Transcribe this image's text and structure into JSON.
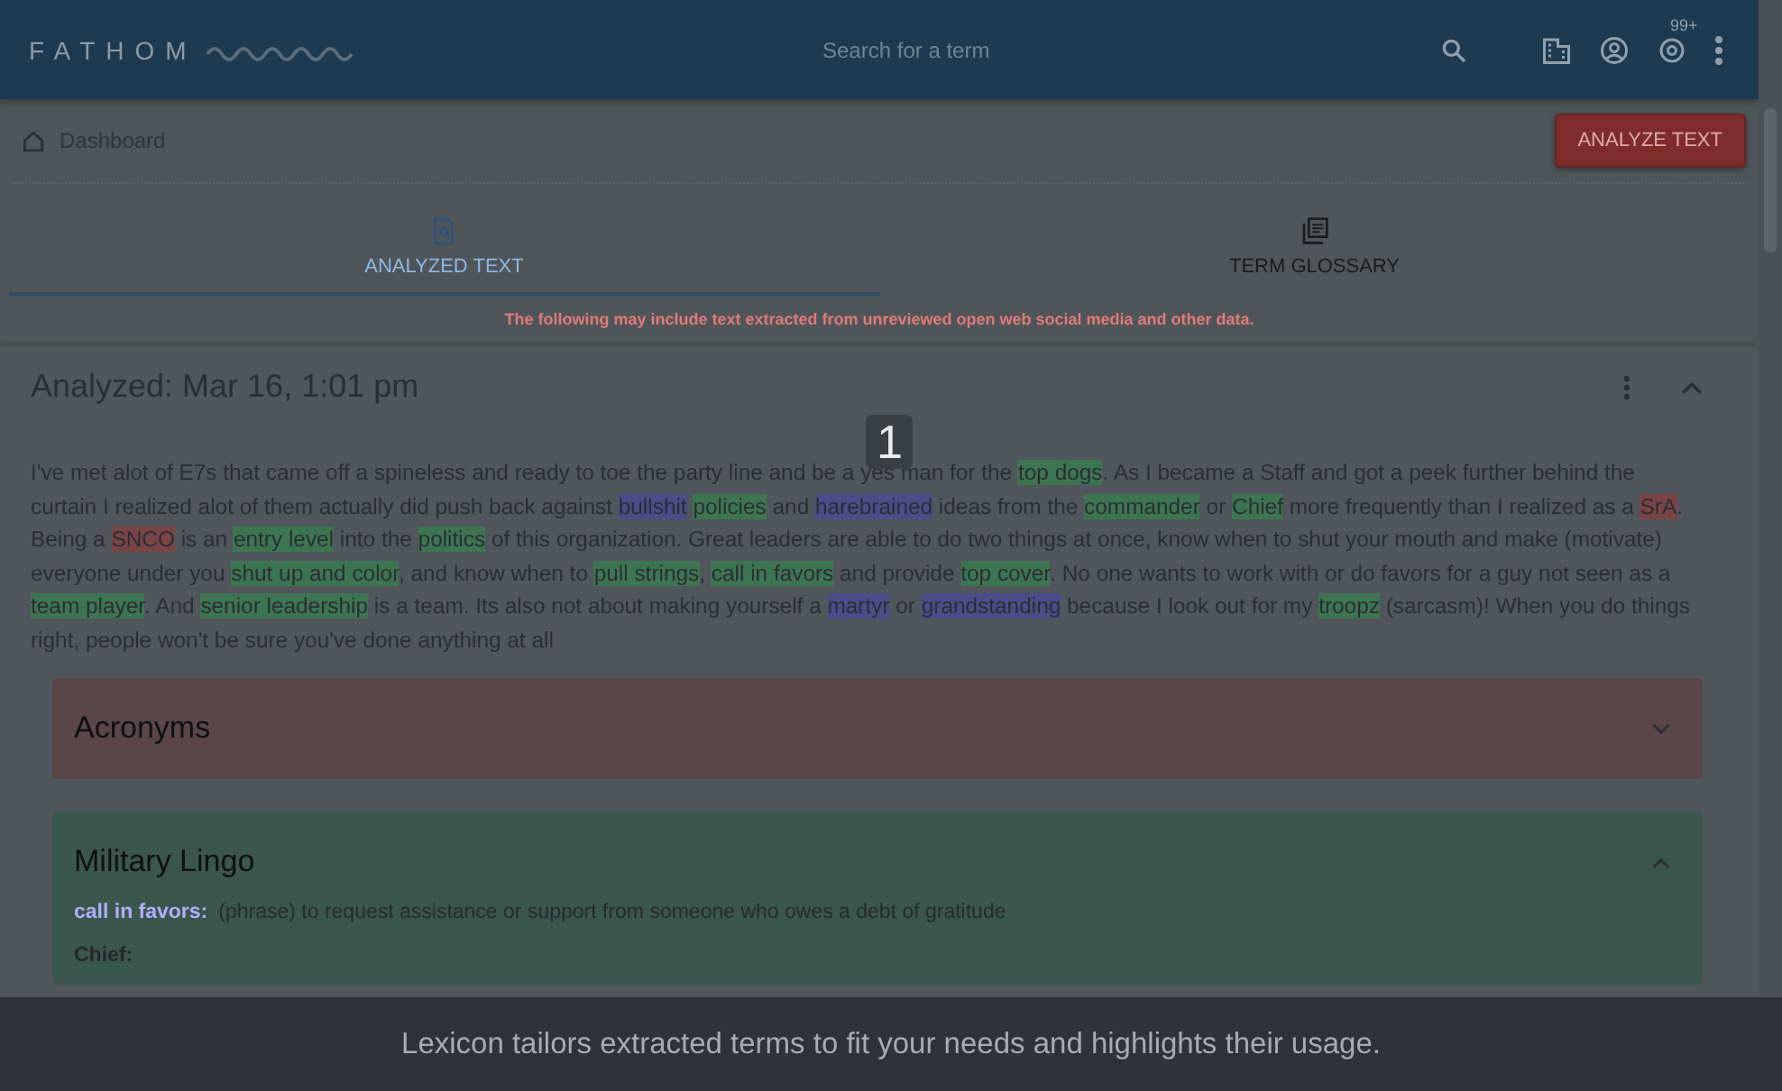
{
  "app_bar": {
    "brand": "FATHOM",
    "search": {
      "placeholder": "Search for a term"
    },
    "notification_badge": "99+"
  },
  "breadcrumb": {
    "label": "Dashboard"
  },
  "analyze_button": "ANALYZE TEXT",
  "tabs": [
    {
      "label": "ANALYZED TEXT",
      "selected": true
    },
    {
      "label": "TERM GLOSSARY",
      "selected": false
    }
  ],
  "notice": "The following may include text extracted from unreviewed open web social media and other data.",
  "analysis": {
    "title": "Analyzed: Mar 16, 1:01 pm",
    "expanded": true,
    "segments": [
      {
        "kind": "text",
        "text": "I've met alot of E7s that came off a spineless and ready to toe the party line and be a yes man for the "
      },
      {
        "kind": "lingo",
        "text": "top dogs"
      },
      {
        "kind": "text",
        "text": ". As I became a Staff and got a peek further behind the curtain I realized alot of them actually did push back against "
      },
      {
        "kind": "slang",
        "text": "bullshit"
      },
      {
        "kind": "lingo",
        "text": "policies"
      },
      {
        "kind": "text",
        "text": " and "
      },
      {
        "kind": "slang",
        "text": "harebrained"
      },
      {
        "kind": "text",
        "text": " ideas from the "
      },
      {
        "kind": "lingo",
        "text": "commander"
      },
      {
        "kind": "text",
        "text": " or "
      },
      {
        "kind": "lingo",
        "text": "Chief"
      },
      {
        "kind": "text",
        "text": " more frequently than I realized as a "
      },
      {
        "kind": "acronym",
        "text": "SrA"
      },
      {
        "kind": "text",
        "text": ". Being a "
      },
      {
        "kind": "acronym",
        "text": "SNCO"
      },
      {
        "kind": "text",
        "text": " is an "
      },
      {
        "kind": "lingo",
        "text": "entry level"
      },
      {
        "kind": "text",
        "text": " into the "
      },
      {
        "kind": "lingo",
        "text": "politics"
      },
      {
        "kind": "text",
        "text": " of this organization. Great leaders are able to do two things at once, know when to shut your mouth and make (motivate) everyone under you "
      },
      {
        "kind": "lingo",
        "text": "shut up and color"
      },
      {
        "kind": "text",
        "text": ", and know when to "
      },
      {
        "kind": "lingo",
        "text": "pull strings"
      },
      {
        "kind": "text",
        "text": ", "
      },
      {
        "kind": "lingo",
        "text": "call in favors"
      },
      {
        "kind": "text",
        "text": " and provide "
      },
      {
        "kind": "lingo",
        "text": "top cover"
      },
      {
        "kind": "text",
        "text": ". No one wants to work with or do favors for a guy not seen as a "
      },
      {
        "kind": "lingo",
        "text": "team player"
      },
      {
        "kind": "text",
        "text": ". And "
      },
      {
        "kind": "lingo",
        "text": "senior leadership"
      },
      {
        "kind": "text",
        "text": " is a team. Its also not about making yourself a "
      },
      {
        "kind": "slang",
        "text": "martyr"
      },
      {
        "kind": "text",
        "text": " or "
      },
      {
        "kind": "slang",
        "text": "grandstanding"
      },
      {
        "kind": "text",
        "text": " because I look out for my "
      },
      {
        "kind": "lingo",
        "text": "troopz"
      },
      {
        "kind": "text",
        "text": " (sarcasm)! When you do things right, people won't be sure you've done anything at all"
      }
    ],
    "panels": [
      {
        "title": "Acronyms",
        "kind": "acronym",
        "expanded": false
      },
      {
        "title": "Military Lingo",
        "kind": "lingo",
        "expanded": true,
        "entries": [
          {
            "term": "call in favors:",
            "kind": "slang",
            "definition": "(phrase) to request assistance or support from someone who owes a debt of gratitude"
          },
          {
            "term": "Chief:",
            "kind": "lingo"
          }
        ]
      }
    ]
  },
  "tour": {
    "step": "1",
    "caption": "Lexicon tailors extracted terms to fit your needs and highlights their usage."
  }
}
